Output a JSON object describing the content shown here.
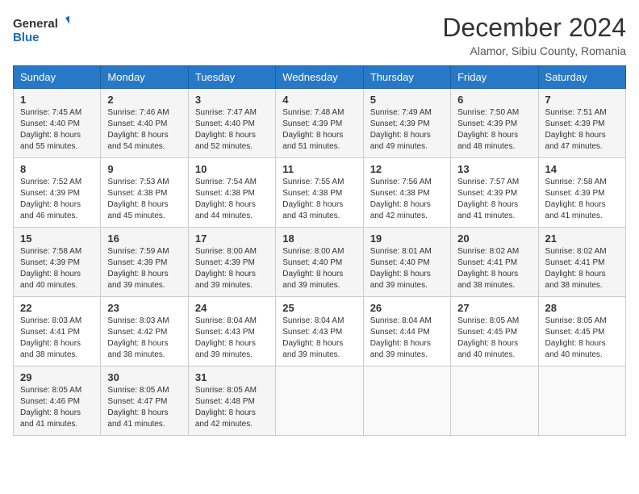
{
  "logo": {
    "line1": "General",
    "line2": "Blue"
  },
  "title": "December 2024",
  "location": "Alamor, Sibiu County, Romania",
  "weekdays": [
    "Sunday",
    "Monday",
    "Tuesday",
    "Wednesday",
    "Thursday",
    "Friday",
    "Saturday"
  ],
  "weeks": [
    [
      {
        "day": 1,
        "sunrise": "7:45 AM",
        "sunset": "4:40 PM",
        "daylight": "8 hours and 55 minutes."
      },
      {
        "day": 2,
        "sunrise": "7:46 AM",
        "sunset": "4:40 PM",
        "daylight": "8 hours and 54 minutes."
      },
      {
        "day": 3,
        "sunrise": "7:47 AM",
        "sunset": "4:40 PM",
        "daylight": "8 hours and 52 minutes."
      },
      {
        "day": 4,
        "sunrise": "7:48 AM",
        "sunset": "4:39 PM",
        "daylight": "8 hours and 51 minutes."
      },
      {
        "day": 5,
        "sunrise": "7:49 AM",
        "sunset": "4:39 PM",
        "daylight": "8 hours and 49 minutes."
      },
      {
        "day": 6,
        "sunrise": "7:50 AM",
        "sunset": "4:39 PM",
        "daylight": "8 hours and 48 minutes."
      },
      {
        "day": 7,
        "sunrise": "7:51 AM",
        "sunset": "4:39 PM",
        "daylight": "8 hours and 47 minutes."
      }
    ],
    [
      {
        "day": 8,
        "sunrise": "7:52 AM",
        "sunset": "4:39 PM",
        "daylight": "8 hours and 46 minutes."
      },
      {
        "day": 9,
        "sunrise": "7:53 AM",
        "sunset": "4:38 PM",
        "daylight": "8 hours and 45 minutes."
      },
      {
        "day": 10,
        "sunrise": "7:54 AM",
        "sunset": "4:38 PM",
        "daylight": "8 hours and 44 minutes."
      },
      {
        "day": 11,
        "sunrise": "7:55 AM",
        "sunset": "4:38 PM",
        "daylight": "8 hours and 43 minutes."
      },
      {
        "day": 12,
        "sunrise": "7:56 AM",
        "sunset": "4:38 PM",
        "daylight": "8 hours and 42 minutes."
      },
      {
        "day": 13,
        "sunrise": "7:57 AM",
        "sunset": "4:39 PM",
        "daylight": "8 hours and 41 minutes."
      },
      {
        "day": 14,
        "sunrise": "7:58 AM",
        "sunset": "4:39 PM",
        "daylight": "8 hours and 41 minutes."
      }
    ],
    [
      {
        "day": 15,
        "sunrise": "7:58 AM",
        "sunset": "4:39 PM",
        "daylight": "8 hours and 40 minutes."
      },
      {
        "day": 16,
        "sunrise": "7:59 AM",
        "sunset": "4:39 PM",
        "daylight": "8 hours and 39 minutes."
      },
      {
        "day": 17,
        "sunrise": "8:00 AM",
        "sunset": "4:39 PM",
        "daylight": "8 hours and 39 minutes."
      },
      {
        "day": 18,
        "sunrise": "8:00 AM",
        "sunset": "4:40 PM",
        "daylight": "8 hours and 39 minutes."
      },
      {
        "day": 19,
        "sunrise": "8:01 AM",
        "sunset": "4:40 PM",
        "daylight": "8 hours and 39 minutes."
      },
      {
        "day": 20,
        "sunrise": "8:02 AM",
        "sunset": "4:41 PM",
        "daylight": "8 hours and 38 minutes."
      },
      {
        "day": 21,
        "sunrise": "8:02 AM",
        "sunset": "4:41 PM",
        "daylight": "8 hours and 38 minutes."
      }
    ],
    [
      {
        "day": 22,
        "sunrise": "8:03 AM",
        "sunset": "4:41 PM",
        "daylight": "8 hours and 38 minutes."
      },
      {
        "day": 23,
        "sunrise": "8:03 AM",
        "sunset": "4:42 PM",
        "daylight": "8 hours and 38 minutes."
      },
      {
        "day": 24,
        "sunrise": "8:04 AM",
        "sunset": "4:43 PM",
        "daylight": "8 hours and 39 minutes."
      },
      {
        "day": 25,
        "sunrise": "8:04 AM",
        "sunset": "4:43 PM",
        "daylight": "8 hours and 39 minutes."
      },
      {
        "day": 26,
        "sunrise": "8:04 AM",
        "sunset": "4:44 PM",
        "daylight": "8 hours and 39 minutes."
      },
      {
        "day": 27,
        "sunrise": "8:05 AM",
        "sunset": "4:45 PM",
        "daylight": "8 hours and 40 minutes."
      },
      {
        "day": 28,
        "sunrise": "8:05 AM",
        "sunset": "4:45 PM",
        "daylight": "8 hours and 40 minutes."
      }
    ],
    [
      {
        "day": 29,
        "sunrise": "8:05 AM",
        "sunset": "4:46 PM",
        "daylight": "8 hours and 41 minutes."
      },
      {
        "day": 30,
        "sunrise": "8:05 AM",
        "sunset": "4:47 PM",
        "daylight": "8 hours and 41 minutes."
      },
      {
        "day": 31,
        "sunrise": "8:05 AM",
        "sunset": "4:48 PM",
        "daylight": "8 hours and 42 minutes."
      },
      null,
      null,
      null,
      null
    ]
  ]
}
